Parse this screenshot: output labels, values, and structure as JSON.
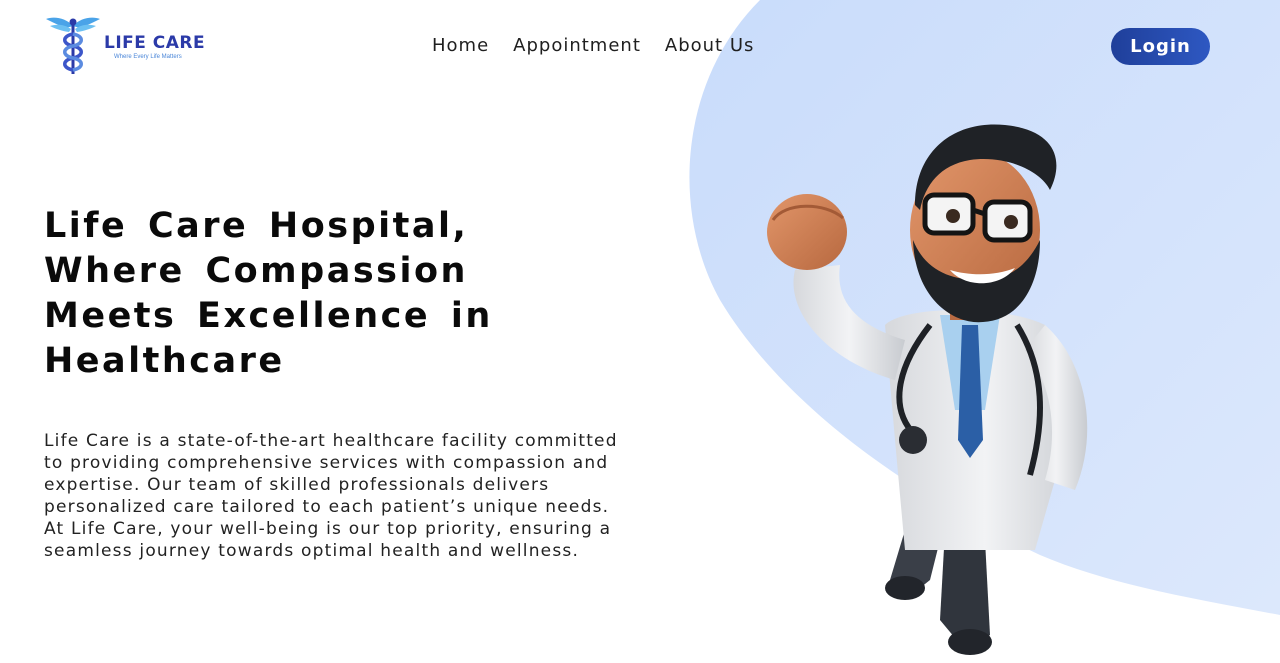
{
  "brand": {
    "name": "LIFE CARE",
    "tagline": "Where Every Life Matters"
  },
  "nav": {
    "items": [
      "Home",
      "Appointment",
      "About Us"
    ]
  },
  "header": {
    "login_label": "Login"
  },
  "hero": {
    "title": "Life Care Hospital, Where Compassion Meets Excellence in Healthcare",
    "description": "Life Care is a state-of-the-art healthcare facility committed to providing comprehensive services with compassion and expertise. Our team of skilled professionals delivers personalized care tailored to each patient’s unique needs. At Life Care, your well-being is our top priority, ensuring a seamless journey towards optimal health and wellness."
  },
  "colors": {
    "brand_blue": "#2b3aa8",
    "button_gradient_start": "#1f3f9a",
    "button_gradient_end": "#2e58c2",
    "hero_blob": "#cfe0fb",
    "text_dark": "#0a0a0a"
  },
  "icons": {
    "logo": "caduceus-icon",
    "hero_image": "doctor-illustration"
  }
}
